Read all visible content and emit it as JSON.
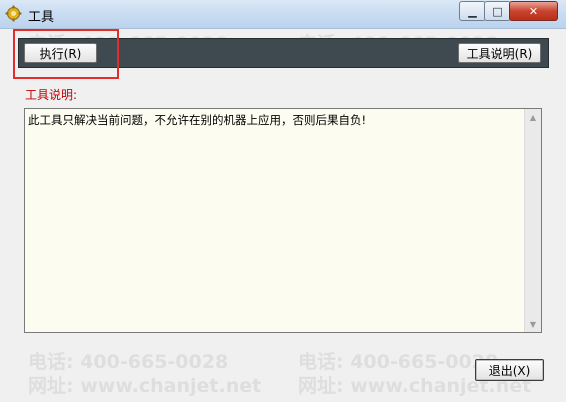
{
  "window": {
    "title": "工具"
  },
  "window_controls": {
    "minimize": "▁",
    "maximize": "□",
    "close": "✕"
  },
  "toolbar": {
    "execute_label": "执行(R)",
    "tool_desc_label": "工具说明(R)"
  },
  "description": {
    "label": "工具说明:",
    "text": "此工具只解决当前问题，不允许在别的机器上应用，否则后果自负!"
  },
  "footer": {
    "exit_label": "退出(X)"
  },
  "watermark": {
    "phone": "电话: 400-665-0028",
    "web": "网址: www.chanjet.net"
  },
  "colors": {
    "toolbar_bg": "#3e4a4f",
    "label_red": "#c00000",
    "highlight": "#e22d2d",
    "textarea_bg": "#fcfcf0"
  }
}
